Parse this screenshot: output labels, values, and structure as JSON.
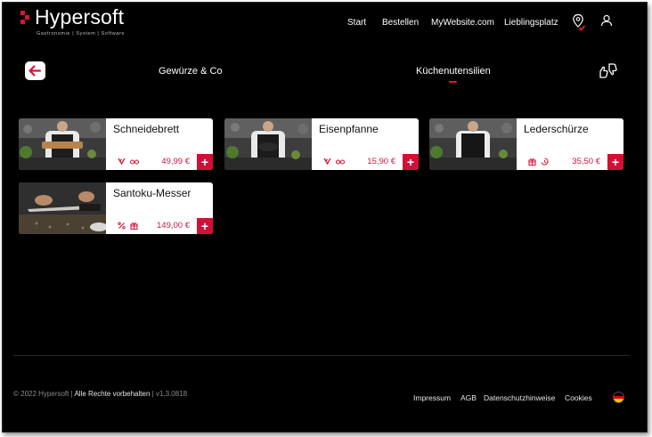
{
  "brand": {
    "name": "Hypersoft",
    "tagline": "Gastronomie | System | Software",
    "accent": "#d9143a"
  },
  "nav": {
    "items": [
      {
        "label": "Start"
      },
      {
        "label": "Bestellen"
      },
      {
        "label": "MyWebsite.com"
      },
      {
        "label": "Lieblingsplatz"
      }
    ],
    "icons": [
      "location-pin-icon",
      "user-icon"
    ]
  },
  "categories": {
    "previous": "Gewürze & Co",
    "active": "Küchenutensilien"
  },
  "products": [
    {
      "name": "Schneidebrett",
      "price": "49,99 €",
      "icons": [
        "vegan-icon",
        "glasses-icon"
      ]
    },
    {
      "name": "Eisenpfanne",
      "price": "15,90 €",
      "icons": [
        "vegan-icon",
        "glasses-icon"
      ]
    },
    {
      "name": "Lederschürze",
      "price": "35,50 €",
      "icons": [
        "gift-icon",
        "timer-icon"
      ]
    },
    {
      "name": "Santoku-Messer",
      "price": "149,00 €",
      "icons": [
        "percent-icon",
        "gift-icon"
      ]
    }
  ],
  "footer": {
    "copyright": "© 2022 Hypersoft |",
    "rights": "Alle Rechte vorbehalten",
    "version": "| v1.3.0818",
    "links": [
      "Impressum",
      "AGB",
      "Datenschutzhinweise",
      "Cookies"
    ],
    "language_icon": "german-flag-icon"
  }
}
